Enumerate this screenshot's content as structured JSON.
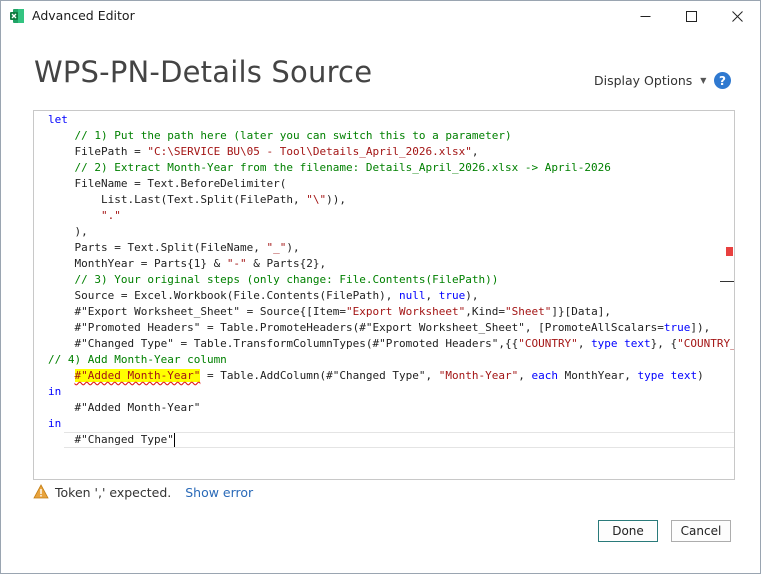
{
  "window": {
    "title": "Advanced Editor"
  },
  "header": {
    "title": "WPS-PN-Details Source",
    "display_options": "Display Options",
    "help": "?"
  },
  "code": [
    [
      {
        "t": "let",
        "c": "kw"
      }
    ],
    [
      {
        "t": "    // 1) Put the path here (later you can switch this to a parameter)",
        "c": "cm"
      }
    ],
    [
      {
        "t": "    FilePath = ",
        "c": ""
      },
      {
        "t": "\"C:\\SERVICE BU\\05 - Tool\\Details_April_2026.xlsx\"",
        "c": "st"
      },
      {
        "t": ",",
        "c": ""
      }
    ],
    [
      {
        "t": "    // 2) Extract Month-Year from the filename: Details_April_2026.xlsx -> April-2026",
        "c": "cm"
      }
    ],
    [
      {
        "t": "    FileName = Text.BeforeDelimiter(",
        "c": ""
      }
    ],
    [
      {
        "t": "        List.Last(Text.Split(FilePath, ",
        "c": ""
      },
      {
        "t": "\"\\\"",
        "c": "st"
      },
      {
        "t": ")),",
        "c": ""
      }
    ],
    [
      {
        "t": "        ",
        "c": ""
      },
      {
        "t": "\".\"",
        "c": "st"
      }
    ],
    [
      {
        "t": "    ),",
        "c": ""
      }
    ],
    [
      {
        "t": "    Parts = Text.Split(FileName, ",
        "c": ""
      },
      {
        "t": "\"_\"",
        "c": "st"
      },
      {
        "t": "),",
        "c": ""
      }
    ],
    [
      {
        "t": "    MonthYear = Parts{1} & ",
        "c": ""
      },
      {
        "t": "\"-\"",
        "c": "st"
      },
      {
        "t": " & Parts{2},",
        "c": ""
      }
    ],
    [
      {
        "t": "    // 3) Your original steps (only change: File.Contents(FilePath))",
        "c": "cm"
      }
    ],
    [
      {
        "t": "    Source = Excel.Workbook(File.Contents(FilePath), ",
        "c": ""
      },
      {
        "t": "null",
        "c": "kw"
      },
      {
        "t": ", ",
        "c": ""
      },
      {
        "t": "true",
        "c": "kw"
      },
      {
        "t": "),",
        "c": ""
      }
    ],
    [
      {
        "t": "    #\"Export Worksheet_Sheet\" = Source{[Item=",
        "c": ""
      },
      {
        "t": "\"Export Worksheet\"",
        "c": "st"
      },
      {
        "t": ",Kind=",
        "c": ""
      },
      {
        "t": "\"Sheet\"",
        "c": "st"
      },
      {
        "t": "]}[Data],",
        "c": ""
      }
    ],
    [
      {
        "t": "    #\"Promoted Headers\" = Table.PromoteHeaders(#\"Export Worksheet_Sheet\", [PromoteAllScalars=",
        "c": ""
      },
      {
        "t": "true",
        "c": "kw"
      },
      {
        "t": "]),",
        "c": ""
      }
    ],
    [
      {
        "t": "    #\"Changed Type\" = Table.TransformColumnTypes(#\"Promoted Headers\",{{",
        "c": ""
      },
      {
        "t": "\"COUNTRY\"",
        "c": "st"
      },
      {
        "t": ", ",
        "c": ""
      },
      {
        "t": "type text",
        "c": "kw"
      },
      {
        "t": "}, {",
        "c": ""
      },
      {
        "t": "\"COUNTRY_",
        "c": "st"
      }
    ],
    [
      {
        "t": "// 4) Add Month-Year column",
        "c": "cm"
      }
    ],
    [
      {
        "t": "    ",
        "c": ""
      },
      {
        "t": "#\"Added Month-Year\"",
        "c": "hl"
      },
      {
        "t": " = Table.AddColumn(#\"Changed Type\", ",
        "c": ""
      },
      {
        "t": "\"Month-Year\"",
        "c": "st"
      },
      {
        "t": ", ",
        "c": ""
      },
      {
        "t": "each",
        "c": "kw"
      },
      {
        "t": " MonthYear, ",
        "c": ""
      },
      {
        "t": "type text",
        "c": "kw"
      },
      {
        "t": ")",
        "c": ""
      }
    ],
    [
      {
        "t": "in",
        "c": "kw"
      }
    ],
    [
      {
        "t": "    #\"Added Month-Year\"",
        "c": ""
      }
    ],
    [
      {
        "t": "in",
        "c": "kw"
      }
    ],
    [
      {
        "t": "    #\"Changed Type\"",
        "c": ""
      }
    ]
  ],
  "status": {
    "message": "Token ',' expected.",
    "link": "Show error"
  },
  "buttons": {
    "done": "Done",
    "cancel": "Cancel"
  },
  "colors": {
    "keyword": "#0000ff",
    "comment": "#008000",
    "string": "#a31515",
    "highlight": "#ffff00",
    "done_border": "#2a7a7a",
    "error_marker": "#e8403f"
  },
  "icons": {
    "app": "excel-icon",
    "minimize": "minimize-icon",
    "maximize": "maximize-icon",
    "close": "close-icon",
    "help": "help-icon",
    "warning": "warning-icon",
    "dropdown": "chevron-down-icon"
  }
}
